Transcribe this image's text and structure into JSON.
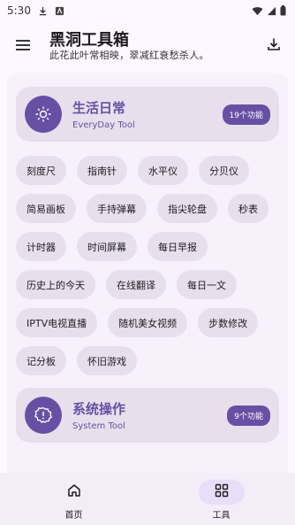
{
  "status_bar": {
    "time": "5:30",
    "icons": [
      "download-icon",
      "notification-a-icon",
      "wifi-icon",
      "signal-icon",
      "battery-icon"
    ]
  },
  "app_bar": {
    "title": "黑洞工具箱",
    "subtitle": "此花此叶常相映，翠减红衰愁杀人。",
    "menu_icon": "menu-icon",
    "action_icon": "download-icon"
  },
  "sections": [
    {
      "title": "生活日常",
      "subtitle": "EveryDay Tool",
      "badge": "19个功能",
      "icon": "sun-icon",
      "tools": [
        "刻度尺",
        "指南针",
        "水平仪",
        "分贝仪",
        "简易画板",
        "手持弹幕",
        "指尖轮盘",
        "秒表",
        "计时器",
        "时间屏幕",
        "每日早报",
        "历史上的今天",
        "在线翻译",
        "每日一文",
        "IPTV电视直播",
        "随机美女视频",
        "步数修改",
        "记分板",
        "怀旧游戏"
      ]
    },
    {
      "title": "系统操作",
      "subtitle": "System Tool",
      "badge": "9个功能",
      "icon": "settings-badge-icon"
    }
  ],
  "bottom_nav": {
    "items": [
      {
        "label": "首页",
        "icon": "home-icon",
        "active": false
      },
      {
        "label": "工具",
        "icon": "grid-icon",
        "active": true
      }
    ]
  },
  "colors": {
    "primary": "#6750a4",
    "background": "#fdf7ff",
    "surface": "#f7f1fb",
    "chip": "#e7e0ec",
    "nav_active": "#e8def8"
  }
}
